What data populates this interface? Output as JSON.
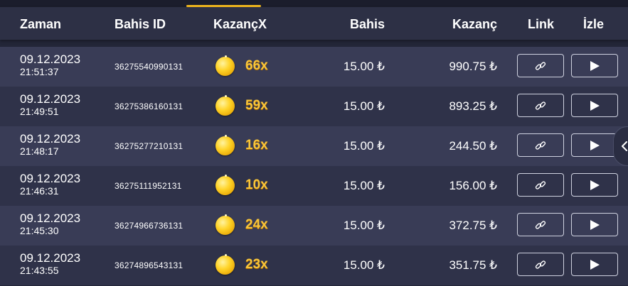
{
  "header": {
    "columns": {
      "time": "Zaman",
      "bet_id": "Bahis ID",
      "multiplier": "KazançX",
      "bet": "Bahis",
      "win": "Kazanç",
      "link": "Link",
      "watch": "İzle"
    }
  },
  "rows": [
    {
      "date": "09.12.2023",
      "time": "21:51:37",
      "bet_id": "36275540990131",
      "multiplier": "66x",
      "bet": "15.00 ₺",
      "win": "990.75 ₺"
    },
    {
      "date": "09.12.2023",
      "time": "21:49:51",
      "bet_id": "36275386160131",
      "multiplier": "59x",
      "bet": "15.00 ₺",
      "win": "893.25 ₺"
    },
    {
      "date": "09.12.2023",
      "time": "21:48:17",
      "bet_id": "36275277210131",
      "multiplier": "16x",
      "bet": "15.00 ₺",
      "win": "244.50 ₺"
    },
    {
      "date": "09.12.2023",
      "time": "21:46:31",
      "bet_id": "36275111952131",
      "multiplier": "10x",
      "bet": "15.00 ₺",
      "win": "156.00 ₺"
    },
    {
      "date": "09.12.2023",
      "time": "21:45:30",
      "bet_id": "36274966736131",
      "multiplier": "24x",
      "bet": "15.00 ₺",
      "win": "372.75 ₺"
    },
    {
      "date": "09.12.2023",
      "time": "21:43:55",
      "bet_id": "36274896543131",
      "multiplier": "23x",
      "bet": "15.00 ₺",
      "win": "351.75 ₺"
    }
  ],
  "icons": {
    "coin": "coin-icon",
    "link": "link-icon",
    "play": "play-icon",
    "collapse": "chevron-left-icon"
  },
  "colors": {
    "accent": "#f2b81e",
    "multiplier": "#f8c53a",
    "header_bg": "#2d3045",
    "row_light": "#393c56",
    "row_dark": "#2f3249"
  }
}
